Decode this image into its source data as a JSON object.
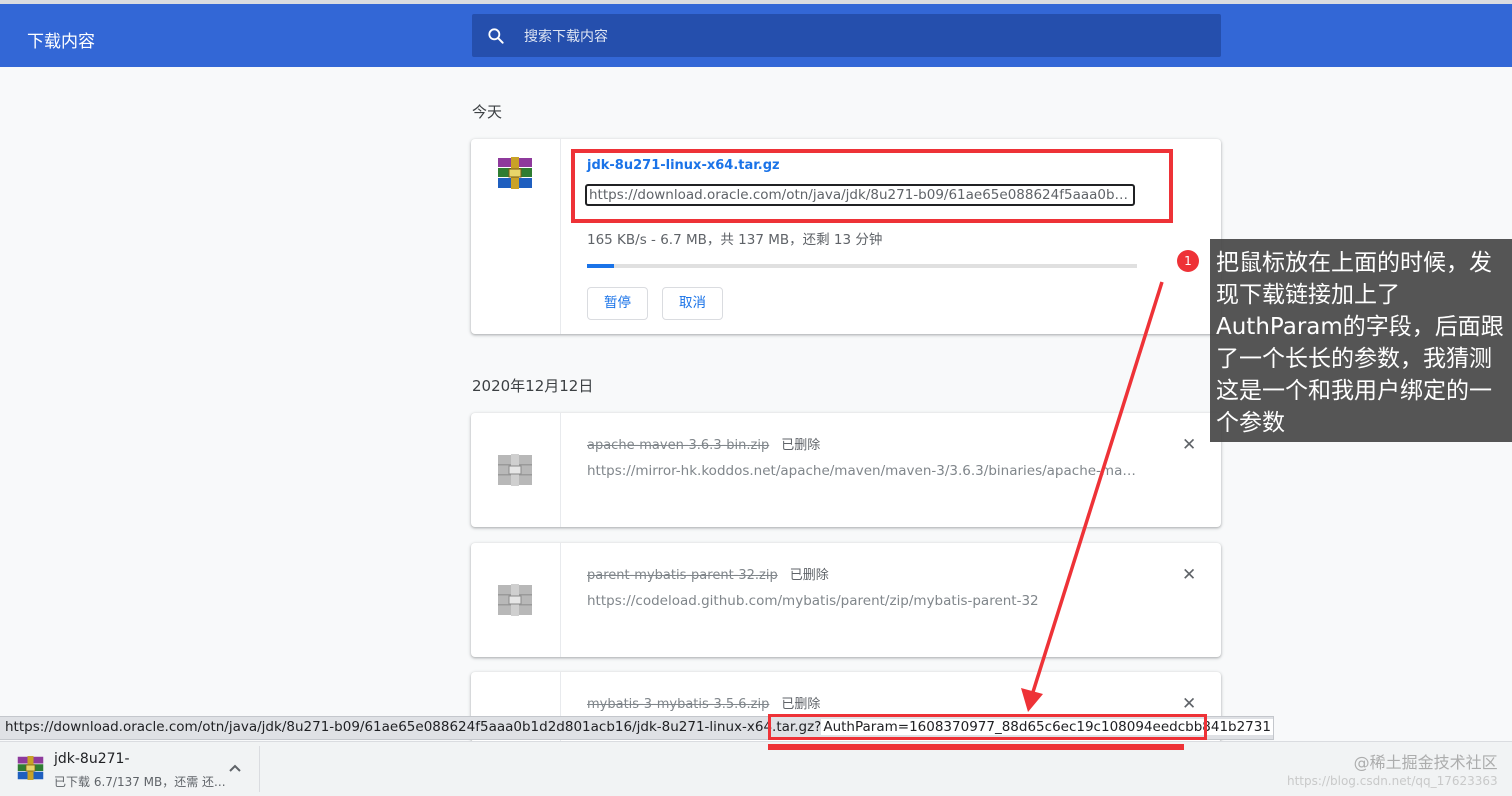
{
  "header": {
    "title": "下载内容",
    "search_placeholder": "搜索下载内容"
  },
  "sections": {
    "today": "今天",
    "dated": "2020年12月12日"
  },
  "active_download": {
    "filename": "jdk-8u271-linux-x64.tar.gz",
    "url": "https://download.oracle.com/otn/java/jdk/8u271-b09/61ae65e088624f5aaa0b1d2d...",
    "status": "165 KB/s - 6.7 MB，共 137 MB，还剩 13 分钟",
    "progress_fraction": 0.049,
    "pause_label": "暂停",
    "cancel_label": "取消"
  },
  "deleted_downloads": [
    {
      "filename": "apache-maven-3.6.3-bin.zip",
      "tag": "已删除",
      "url": "https://mirror-hk.koddos.net/apache/maven/maven-3/3.6.3/binaries/apache-maven-..."
    },
    {
      "filename": "parent-mybatis-parent-32.zip",
      "tag": "已删除",
      "url": "https://codeload.github.com/mybatis/parent/zip/mybatis-parent-32"
    },
    {
      "filename": "mybatis-3-mybatis-3.5.6.zip",
      "tag": "已删除",
      "url": ""
    }
  ],
  "close_glyph": "✕",
  "annotation": {
    "badge": "1",
    "text": "把鼠标放在上面的时候，发现下载链接加上了AuthParam的字段，后面跟了一个长长的参数，我猜测这是一个和我用户绑定的一个参数",
    "color": "#ee3237"
  },
  "hover_status": {
    "url": "https://download.oracle.com/otn/java/jdk/8u271-b09/61ae65e088624f5aaa0b1d2d801acb16/jdk-8u271-linux-x64.tar.gz?",
    "auth_param": "AuthParam=1608370977_88d65c6ec19c108094eedcbb841b2731"
  },
  "shelf": {
    "name": "jdk-8u271-",
    "status": "已下载 6.7/137 MB，还需 还..."
  },
  "watermark": {
    "line1": "@稀土掘金技术社区",
    "line2": "https://blog.csdn.net/qq_17623363"
  },
  "colors": {
    "header_bg": "#3367d6",
    "search_bg": "#254fad",
    "link_blue": "#1a73e8"
  }
}
